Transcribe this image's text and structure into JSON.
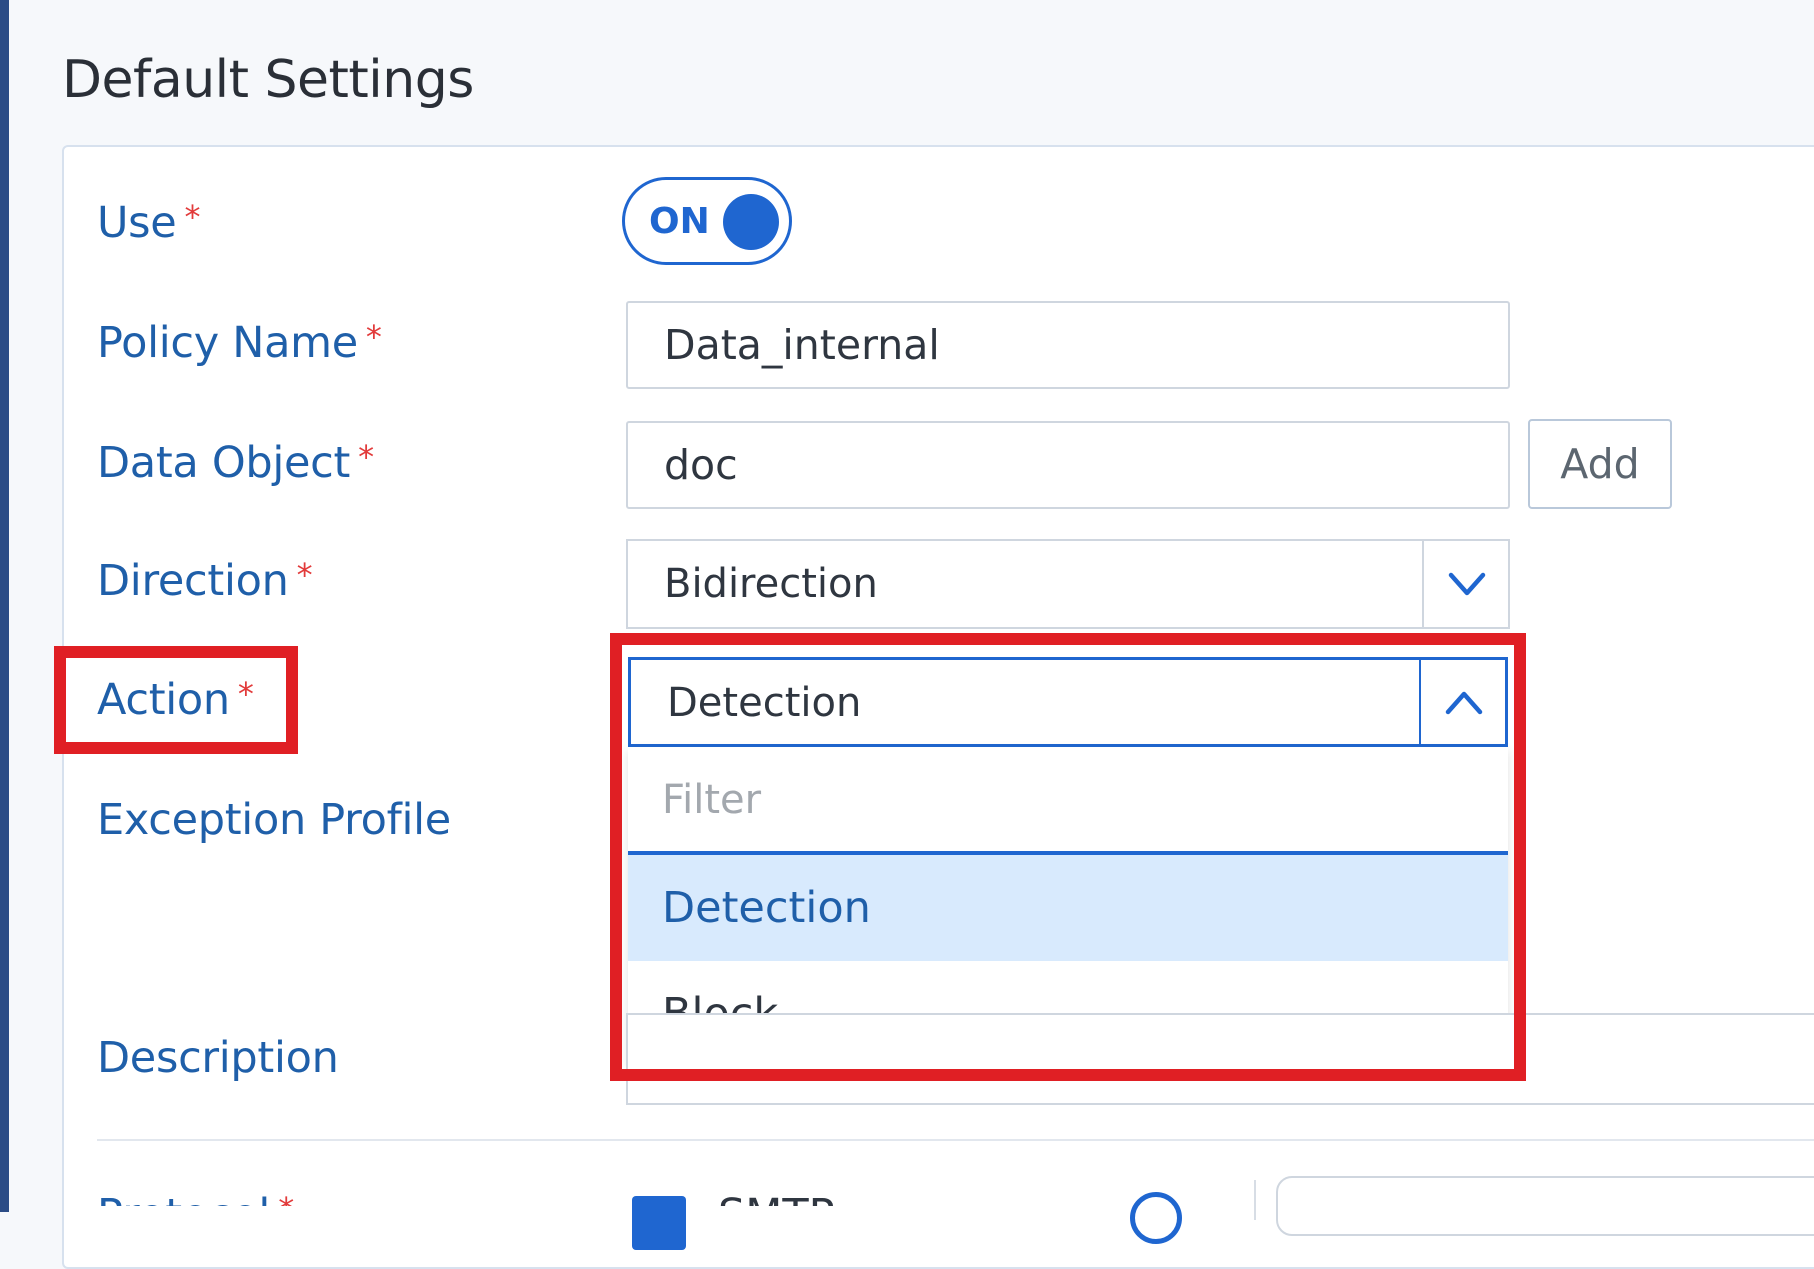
{
  "section_title": "Default Settings",
  "fields": {
    "use": {
      "label": "Use",
      "required": "*",
      "toggle_text": "ON"
    },
    "policy_name": {
      "label": "Policy Name",
      "required": "*",
      "value": "Data_internal"
    },
    "data_object": {
      "label": "Data Object",
      "required": "*",
      "value": "doc",
      "add_label": "Add"
    },
    "direction": {
      "label": "Direction",
      "required": "*",
      "value": "Bidirection"
    },
    "action": {
      "label": "Action",
      "required": "*",
      "value": "Detection",
      "filter_placeholder": "Filter",
      "options": [
        "Detection",
        "Block"
      ]
    },
    "exception_profile": {
      "label": "Exception Profile"
    },
    "description": {
      "label": "Description"
    },
    "protocol": {
      "label": "Protocol",
      "required": "*",
      "option": "SMTP"
    }
  },
  "colors": {
    "accent": "#1f66d0",
    "label": "#1f5fa9",
    "required": "#e23b3b",
    "highlight": "#e01f24"
  }
}
